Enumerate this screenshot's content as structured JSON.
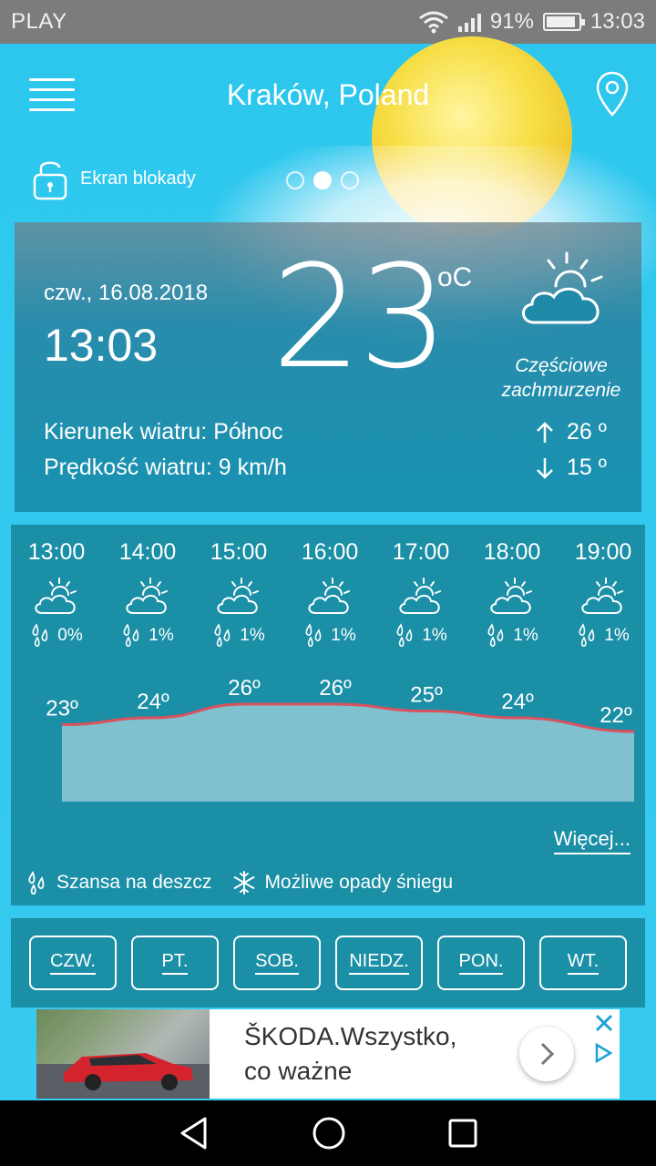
{
  "status_bar": {
    "carrier": "PLAY",
    "battery": "91%",
    "time": "13:03"
  },
  "header": {
    "city": "Kraków, Poland",
    "lock_label": "Ekran blokady",
    "page_dots": 3,
    "active_dot": 1
  },
  "current": {
    "date": "czw., 16.08.2018",
    "time": "13:03",
    "temp": "23",
    "unit": "oC",
    "condition_line1": "Częściowe",
    "condition_line2": "zachmurzenie",
    "wind_direction": "Kierunek wiatru: Północ",
    "wind_speed": "Prędkość wiatru: 9 km/h",
    "high": "26 º",
    "low": "15 º"
  },
  "hourly": [
    {
      "time": "13:00",
      "rain": "0%",
      "temp": "23º",
      "temp_value": 23
    },
    {
      "time": "14:00",
      "rain": "1%",
      "temp": "24º",
      "temp_value": 24
    },
    {
      "time": "15:00",
      "rain": "1%",
      "temp": "26º",
      "temp_value": 26
    },
    {
      "time": "16:00",
      "rain": "1%",
      "temp": "26º",
      "temp_value": 26
    },
    {
      "time": "17:00",
      "rain": "1%",
      "temp": "25º",
      "temp_value": 25
    },
    {
      "time": "18:00",
      "rain": "1%",
      "temp": "24º",
      "temp_value": 24
    },
    {
      "time": "19:00",
      "rain": "1%",
      "temp": "22º",
      "temp_value": 22
    }
  ],
  "more_label": "Więcej...",
  "legend": {
    "rain": "Szansa na deszcz",
    "snow": "Możliwe opady śniegu"
  },
  "days": [
    "CZW.",
    "PT.",
    "SOB.",
    "NIEDZ.",
    "PON.",
    "WT."
  ],
  "ad": {
    "title_line1": "ŠKODA.Wszystko,",
    "title_line2": "co ważne"
  },
  "colors": {
    "sky": "#32c8ee",
    "panel": "#1a8fa6",
    "temp_line": "#d9525e",
    "chart_fill": "#7fc1cf"
  }
}
